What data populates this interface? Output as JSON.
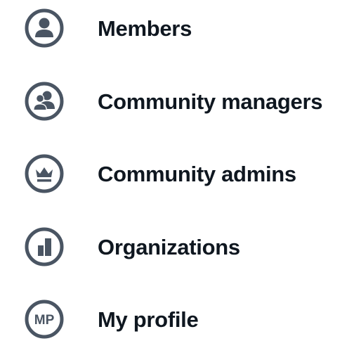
{
  "icon_color": "#4a5563",
  "text_color": "#0f1720",
  "menu": {
    "items": [
      {
        "label": "Members",
        "icon": "user-icon"
      },
      {
        "label": "Community managers",
        "icon": "users-icon"
      },
      {
        "label": "Community admins",
        "icon": "crown-icon"
      },
      {
        "label": "Organizations",
        "icon": "building-icon"
      },
      {
        "label": "My profile",
        "icon": "profile-initials-icon",
        "icon_text": "MP"
      }
    ]
  }
}
